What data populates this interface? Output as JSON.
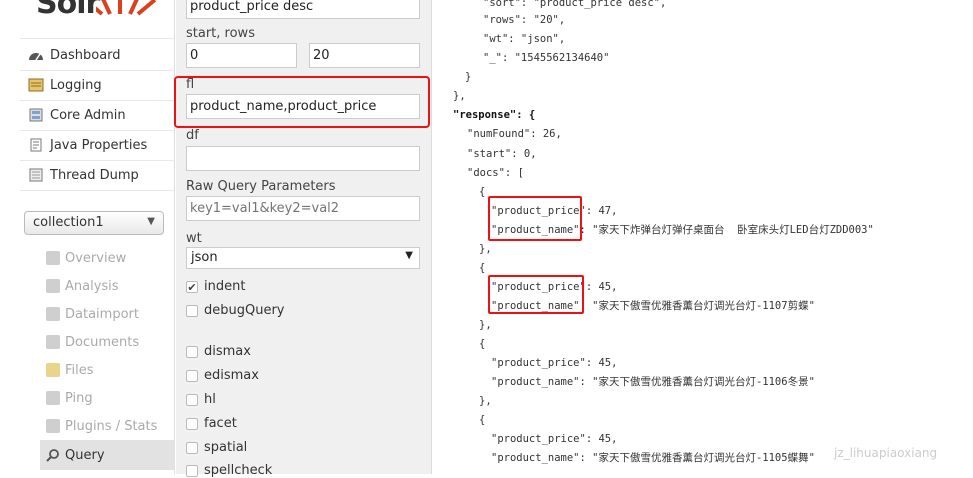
{
  "logo": {
    "text": "Solr"
  },
  "nav": {
    "items": [
      {
        "label": "Dashboard",
        "icon": "dashboard-icon"
      },
      {
        "label": "Logging",
        "icon": "logging-icon"
      },
      {
        "label": "Core Admin",
        "icon": "core-admin-icon"
      },
      {
        "label": "Java Properties",
        "icon": "java-properties-icon"
      },
      {
        "label": "Thread Dump",
        "icon": "thread-dump-icon"
      }
    ]
  },
  "collection": {
    "selected": "collection1"
  },
  "subnav": {
    "items": [
      {
        "label": "Overview"
      },
      {
        "label": "Analysis"
      },
      {
        "label": "Dataimport"
      },
      {
        "label": "Documents"
      },
      {
        "label": "Files"
      },
      {
        "label": "Ping"
      },
      {
        "label": "Plugins / Stats"
      },
      {
        "label": "Query"
      }
    ]
  },
  "form": {
    "sort_value": "product_price desc",
    "start_rows_label": "start, rows",
    "start_value": "0",
    "rows_value": "20",
    "fl_label": "fl",
    "fl_value": "product_name,product_price",
    "df_label": "df",
    "df_value": "",
    "raw_label": "Raw Query Parameters",
    "raw_placeholder": "key1=val1&key2=val2",
    "wt_label": "wt",
    "wt_value": "json",
    "indent_label": "indent",
    "debug_label": "debugQuery",
    "dismax_label": "dismax",
    "edismax_label": "edismax",
    "hl_label": "hl",
    "facet_label": "facet",
    "spatial_label": "spatial",
    "spellcheck_label": "spellcheck"
  },
  "response": {
    "lines": [
      {
        "text": "\"sort\": \"product_price desc\","
      },
      {
        "text": "\"rows\": \"20\","
      },
      {
        "text": "\"wt\": \"json\","
      },
      {
        "text": "\"_\": \"1545562134640\""
      },
      {
        "text": "}"
      },
      {
        "text": "},"
      },
      {
        "text": "\"response\": {"
      },
      {
        "text": "\"numFound\": 26,"
      },
      {
        "text": "\"start\": 0,"
      },
      {
        "text": "\"docs\": ["
      },
      {
        "text": "{"
      },
      {
        "text": "\"product_price\": 47,"
      },
      {
        "text": "\"product_name\": \"家天下炸弹台灯弹仔桌面台  卧室床头灯LED台灯ZDD003\""
      },
      {
        "text": "},"
      },
      {
        "text": "{"
      },
      {
        "text": "\"product_price\": 45,"
      },
      {
        "text": "\"product_name\": \"家天下傲雪优雅香薰台灯调光台灯-1107剪蝶\""
      },
      {
        "text": "},"
      },
      {
        "text": "{"
      },
      {
        "text": "\"product_price\": 45,"
      },
      {
        "text": "\"product_name\": \"家天下傲雪优雅香薰台灯调光台灯-1106冬景\""
      },
      {
        "text": "},"
      },
      {
        "text": "{"
      },
      {
        "text": "\"product_price\": 45,"
      },
      {
        "text": "\"product_name\": \"家天下傲雪优雅香薰台灯调光台灯-1105蝶舞\""
      }
    ]
  },
  "watermark": "jz_lihuapiaoxiang"
}
